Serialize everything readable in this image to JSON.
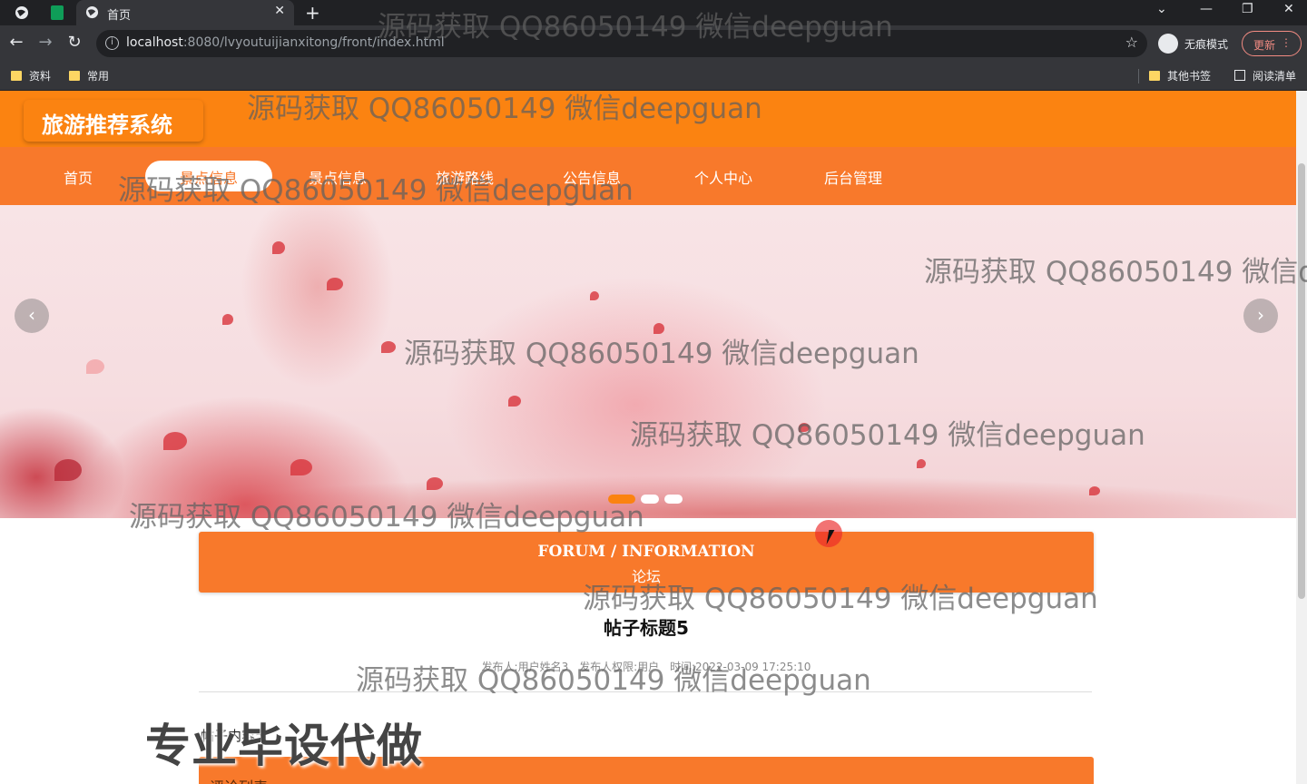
{
  "browser": {
    "tab_title": "首页",
    "url_host": "localhost",
    "url_rest": ":8080/lvyoutuijianxitong/front/index.html",
    "incognito_label": "无痕模式",
    "update_label": "更新",
    "bookmarks": [
      "资料",
      "常用"
    ],
    "other_bookmarks": "其他书签",
    "reading_list": "阅读清单",
    "icons": {
      "back": "←",
      "forward": "→",
      "reload": "↻",
      "info": "i",
      "star": "☆",
      "close": "✕",
      "newtab": "+",
      "minimize": "—",
      "maximize": "❐",
      "window_close": "✕",
      "more": "⋮",
      "collapse": "⌄"
    }
  },
  "site": {
    "logo": "旅游推荐系统",
    "nav": [
      "首页",
      "景点信息",
      "旅游路线",
      "公告信息",
      "个人中心",
      "后台管理"
    ],
    "carousel": {
      "slide_count": 3,
      "active_slide": 1,
      "prev_icon": "‹",
      "next_icon": "›"
    },
    "forum": {
      "title_en": "FORUM / INFORMATION",
      "title_zh": "论坛"
    },
    "post": {
      "title": "帖子标题5",
      "author_label": "发布人:用户姓名3",
      "role_label": "发布人权限:用户",
      "time_label": "时间:2022-03-09 17:25:10",
      "content": "帖子内容5"
    },
    "comments_label": "评论列表"
  },
  "overlay": {
    "watermark": "源码获取 QQ86050149 微信deepguan",
    "promo": "专业毕设代做"
  },
  "colors": {
    "primary_orange": "#fb8311",
    "nav_orange": "#f8792b"
  }
}
